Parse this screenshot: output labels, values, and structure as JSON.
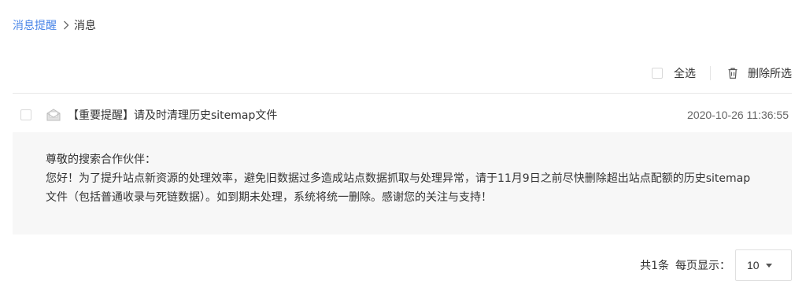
{
  "breadcrumb": {
    "parent": "消息提醒",
    "current": "消息"
  },
  "toolbar": {
    "select_all": "全选",
    "delete_selected": "删除所选"
  },
  "messages": [
    {
      "title": "【重要提醒】请及时清理历史sitemap文件",
      "time": "2020-10-26 11:36:55",
      "body": {
        "greeting": "尊敬的搜索合作伙伴：",
        "line1": "您好！为了提升站点新资源的处理效率，避免旧数据过多造成站点数据抓取与处理异常，请于11月9日之前尽快删除超出站点配额的历史sitemap",
        "line2": "文件（包括普通收录与死链数据）。如到期未处理，系统将统一删除。感谢您的关注与支持！"
      }
    }
  ],
  "pagination": {
    "total": "共1条",
    "page_size_label": "每页显示：",
    "page_size_value": "10"
  },
  "colors": {
    "link": "#4a86e8",
    "body_bg": "#f7f7f7",
    "divider": "#e8e8e8"
  },
  "icons": {
    "separator": "chevron-right-icon",
    "trash": "trash-icon",
    "mail": "mail-icon",
    "caret": "caret-down-icon"
  }
}
